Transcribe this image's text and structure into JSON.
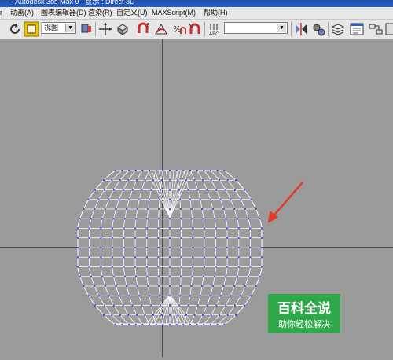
{
  "window": {
    "title": "- Autodesk 3ds Max 9          - 显示 : Direct 3D"
  },
  "menubar": {
    "items": [
      {
        "label": "r"
      },
      {
        "label": "动画(A)"
      },
      {
        "label": "图表编辑器(D)"
      },
      {
        "label": "渲染(R)"
      },
      {
        "label": "自定义(U)"
      },
      {
        "label": "MAXScript(M)"
      },
      {
        "label": "帮助(H)"
      }
    ]
  },
  "toolbar": {
    "reference_coord_value": "视图",
    "named_selection_value": "",
    "icons": [
      "undo-icon",
      "select-region-icon",
      "select-manipulate-icon",
      "move-icon",
      "rotate-icon",
      "angle-snap-icon",
      "percent-snap-icon",
      "spinner-snap-icon",
      "edit-named-selection-icon",
      "mirror-icon",
      "align-icon",
      "layer-manager-icon",
      "curve-editor-icon",
      "schematic-view-icon"
    ]
  },
  "viewport": {
    "background": "#9b9b9b",
    "wireframe_color": "#ffffff",
    "vertex_color": "#4040ff",
    "annotation_color": "#e23a2a"
  },
  "watermark": {
    "title": "百科全说",
    "subtitle": "助你轻松解决",
    "color": "#2fa84a"
  }
}
